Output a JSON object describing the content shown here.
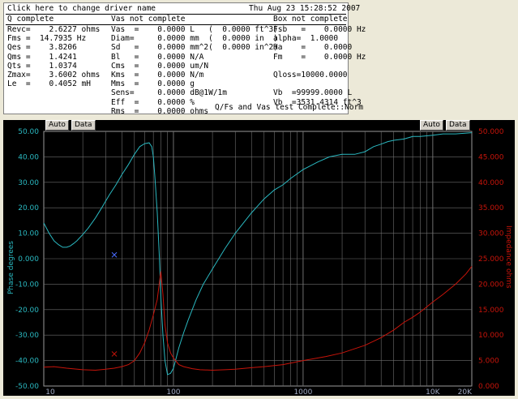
{
  "header": {
    "title": "Click here to change driver name",
    "date": "Thu Aug 23 15:28:52 2007"
  },
  "sections": {
    "q": "Q complete",
    "vas": "Vas not complete",
    "box": "Box not complete"
  },
  "col1": [
    "Revc=    2.6227 ohms",
    "Fms =  14.7935 Hz",
    "Qes =    3.8206",
    "Qms =    1.4241",
    "Qts =    1.0374",
    "Zmax=    3.6002 ohms",
    "Le  =    0.4052 mH"
  ],
  "col2": [
    "Vas  =    0.0000 L   (  0.0000 ft^3)",
    "Diam=     0.0000 mm  (  0.0000 in  )",
    "Sd   =    0.0000 mm^2(  0.0000 in^2)",
    "Bl   =    0.0000 N/A",
    "Cms  =    0.0000 um/N",
    "Kms  =    0.0000 N/m",
    "Mms  =    0.0000 g",
    "Sens=     0.0000 dB@1W/1m",
    "Eff  =    0.0000 %",
    "Rms  =    0.0000 ohms"
  ],
  "col3": [
    "Fsb   =    0.0000 Hz",
    "alpha=  1.0000",
    "Ha    =    0.0000",
    "Fm    =    0.0000 Hz",
    "",
    "Qloss=10000.0000",
    "",
    "Vb  =99999.0000 L",
    "Vb  =3531.4314 ft^3"
  ],
  "status": "Q/Fs and Vas test Complete::Norm",
  "toolbar": {
    "auto_left": "Auto",
    "data_left": "Data",
    "auto_right": "Auto",
    "data_right": "Data"
  },
  "colors": {
    "phase": "#2ab8c0",
    "impedance": "#c8140a",
    "marker": "#4a6cff",
    "grid": "#6e6e6e"
  },
  "chart_data": {
    "type": "line",
    "xscale": "log",
    "xlim": [
      10,
      20000
    ],
    "xticks": [
      10,
      100,
      1000,
      10000,
      20000
    ],
    "xtick_labels": [
      "10",
      "100",
      "1000",
      "10K",
      "20K"
    ],
    "ylabel": "Phase degrees",
    "ylim": [
      -50,
      50
    ],
    "yticks": [
      "50.00",
      "40.00",
      "30.00",
      "20.00",
      "10.00",
      "0.000",
      "-10.00",
      "-20.00",
      "-30.00",
      "-40.00",
      "-50.00"
    ],
    "y2label": "Impedance ohms",
    "y2lim": [
      0,
      50
    ],
    "y2ticks": [
      "50.000",
      "45.000",
      "40.000",
      "35.000",
      "30.000",
      "25.000",
      "20.000",
      "15.000",
      "10.000",
      "5.000",
      "0.000"
    ],
    "series": [
      {
        "axis": "y",
        "x": [
          10,
          11,
          12,
          13,
          14,
          15,
          16,
          17,
          18,
          20,
          22,
          25,
          28,
          32,
          36,
          40,
          45,
          50,
          55,
          60,
          65,
          68,
          70,
          72,
          75,
          78,
          80,
          83,
          86,
          90,
          95,
          100,
          105,
          110,
          120,
          130,
          150,
          170,
          200,
          250,
          300,
          400,
          500,
          600,
          700,
          800,
          1000,
          1300,
          1600,
          2000,
          2500,
          3000,
          3500,
          4000,
          4500,
          5000,
          6000,
          7000,
          8000,
          10000,
          12000,
          15000,
          20000
        ],
        "values": [
          14,
          10,
          7,
          5.5,
          4.5,
          4.5,
          5,
          6,
          7,
          9.5,
          12,
          16,
          20,
          25,
          29,
          33,
          37,
          41,
          44,
          45.2,
          45.5,
          44,
          40,
          32,
          18,
          0,
          -15,
          -30,
          -40,
          -45.5,
          -45,
          -43,
          -39,
          -35,
          -29,
          -24,
          -16,
          -10,
          -4,
          4,
          10,
          18,
          23.5,
          27,
          29,
          31.5,
          35,
          38,
          40,
          41,
          41,
          42,
          44,
          45,
          46,
          46.5,
          47,
          48,
          48,
          48.5,
          49,
          49,
          49.5
        ]
      },
      {
        "axis": "y2",
        "x": [
          10,
          12,
          15,
          20,
          25,
          30,
          35,
          40,
          45,
          50,
          55,
          60,
          65,
          70,
          75,
          80,
          83,
          86,
          90,
          95,
          100,
          110,
          120,
          140,
          160,
          200,
          250,
          300,
          400,
          500,
          700,
          1000,
          1500,
          2000,
          3000,
          4000,
          5000,
          6000,
          7000,
          8000,
          10000,
          12000,
          15000,
          18000,
          20000
        ],
        "values": [
          3.7,
          3.8,
          3.5,
          3.2,
          3.1,
          3.3,
          3.5,
          3.8,
          4.2,
          5,
          6.5,
          8.5,
          11,
          14,
          17,
          22.5,
          18,
          12,
          8.5,
          6.5,
          5.5,
          4.2,
          3.8,
          3.4,
          3.2,
          3.1,
          3.2,
          3.3,
          3.6,
          3.8,
          4.2,
          5,
          5.8,
          6.5,
          8,
          9.5,
          11,
          12.5,
          13.5,
          14.5,
          16.5,
          18,
          20,
          22,
          23.5
        ]
      }
    ],
    "markers": [
      {
        "axis": "y",
        "x": 35,
        "value": 1.5
      },
      {
        "axis": "y2",
        "x": 35,
        "value": 6.3
      }
    ]
  }
}
